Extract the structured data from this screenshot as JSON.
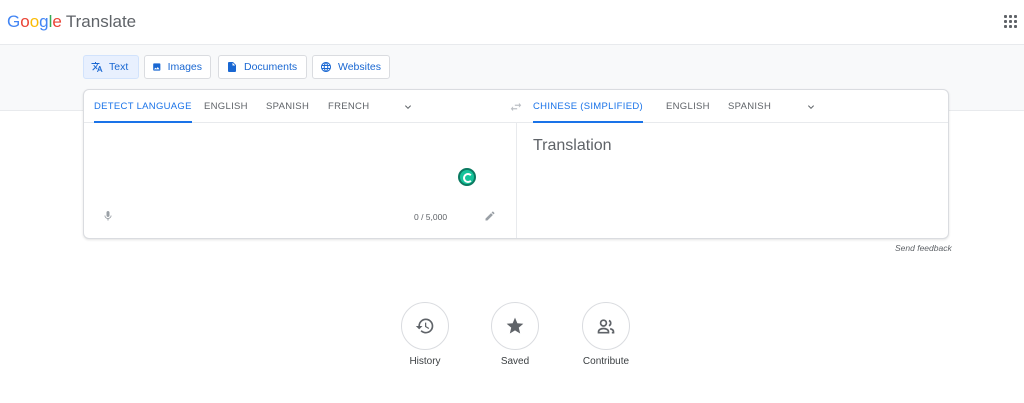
{
  "header": {
    "logo_text": "Google",
    "product": "Translate"
  },
  "modes": [
    {
      "label": "Text",
      "active": true,
      "icon": "translate-icon"
    },
    {
      "label": "Images",
      "active": false,
      "icon": "image-icon"
    },
    {
      "label": "Documents",
      "active": false,
      "icon": "document-icon"
    },
    {
      "label": "Websites",
      "active": false,
      "icon": "globe-icon"
    }
  ],
  "source": {
    "languages": [
      "DETECT LANGUAGE",
      "ENGLISH",
      "SPANISH",
      "FRENCH"
    ],
    "active": "DETECT LANGUAGE",
    "char_count": "0 / 5,000"
  },
  "target": {
    "languages": [
      "CHINESE (SIMPLIFIED)",
      "ENGLISH",
      "SPANISH"
    ],
    "active": "CHINESE (SIMPLIFIED)",
    "placeholder": "Translation"
  },
  "feedback": "Send feedback",
  "actions": [
    {
      "label": "History",
      "icon": "history-icon"
    },
    {
      "label": "Saved",
      "icon": "star-icon"
    },
    {
      "label": "Contribute",
      "icon": "people-icon"
    }
  ],
  "colors": {
    "accent": "#1a73e8",
    "band": "#f8f9fa",
    "grammarly": "#15c39a"
  }
}
